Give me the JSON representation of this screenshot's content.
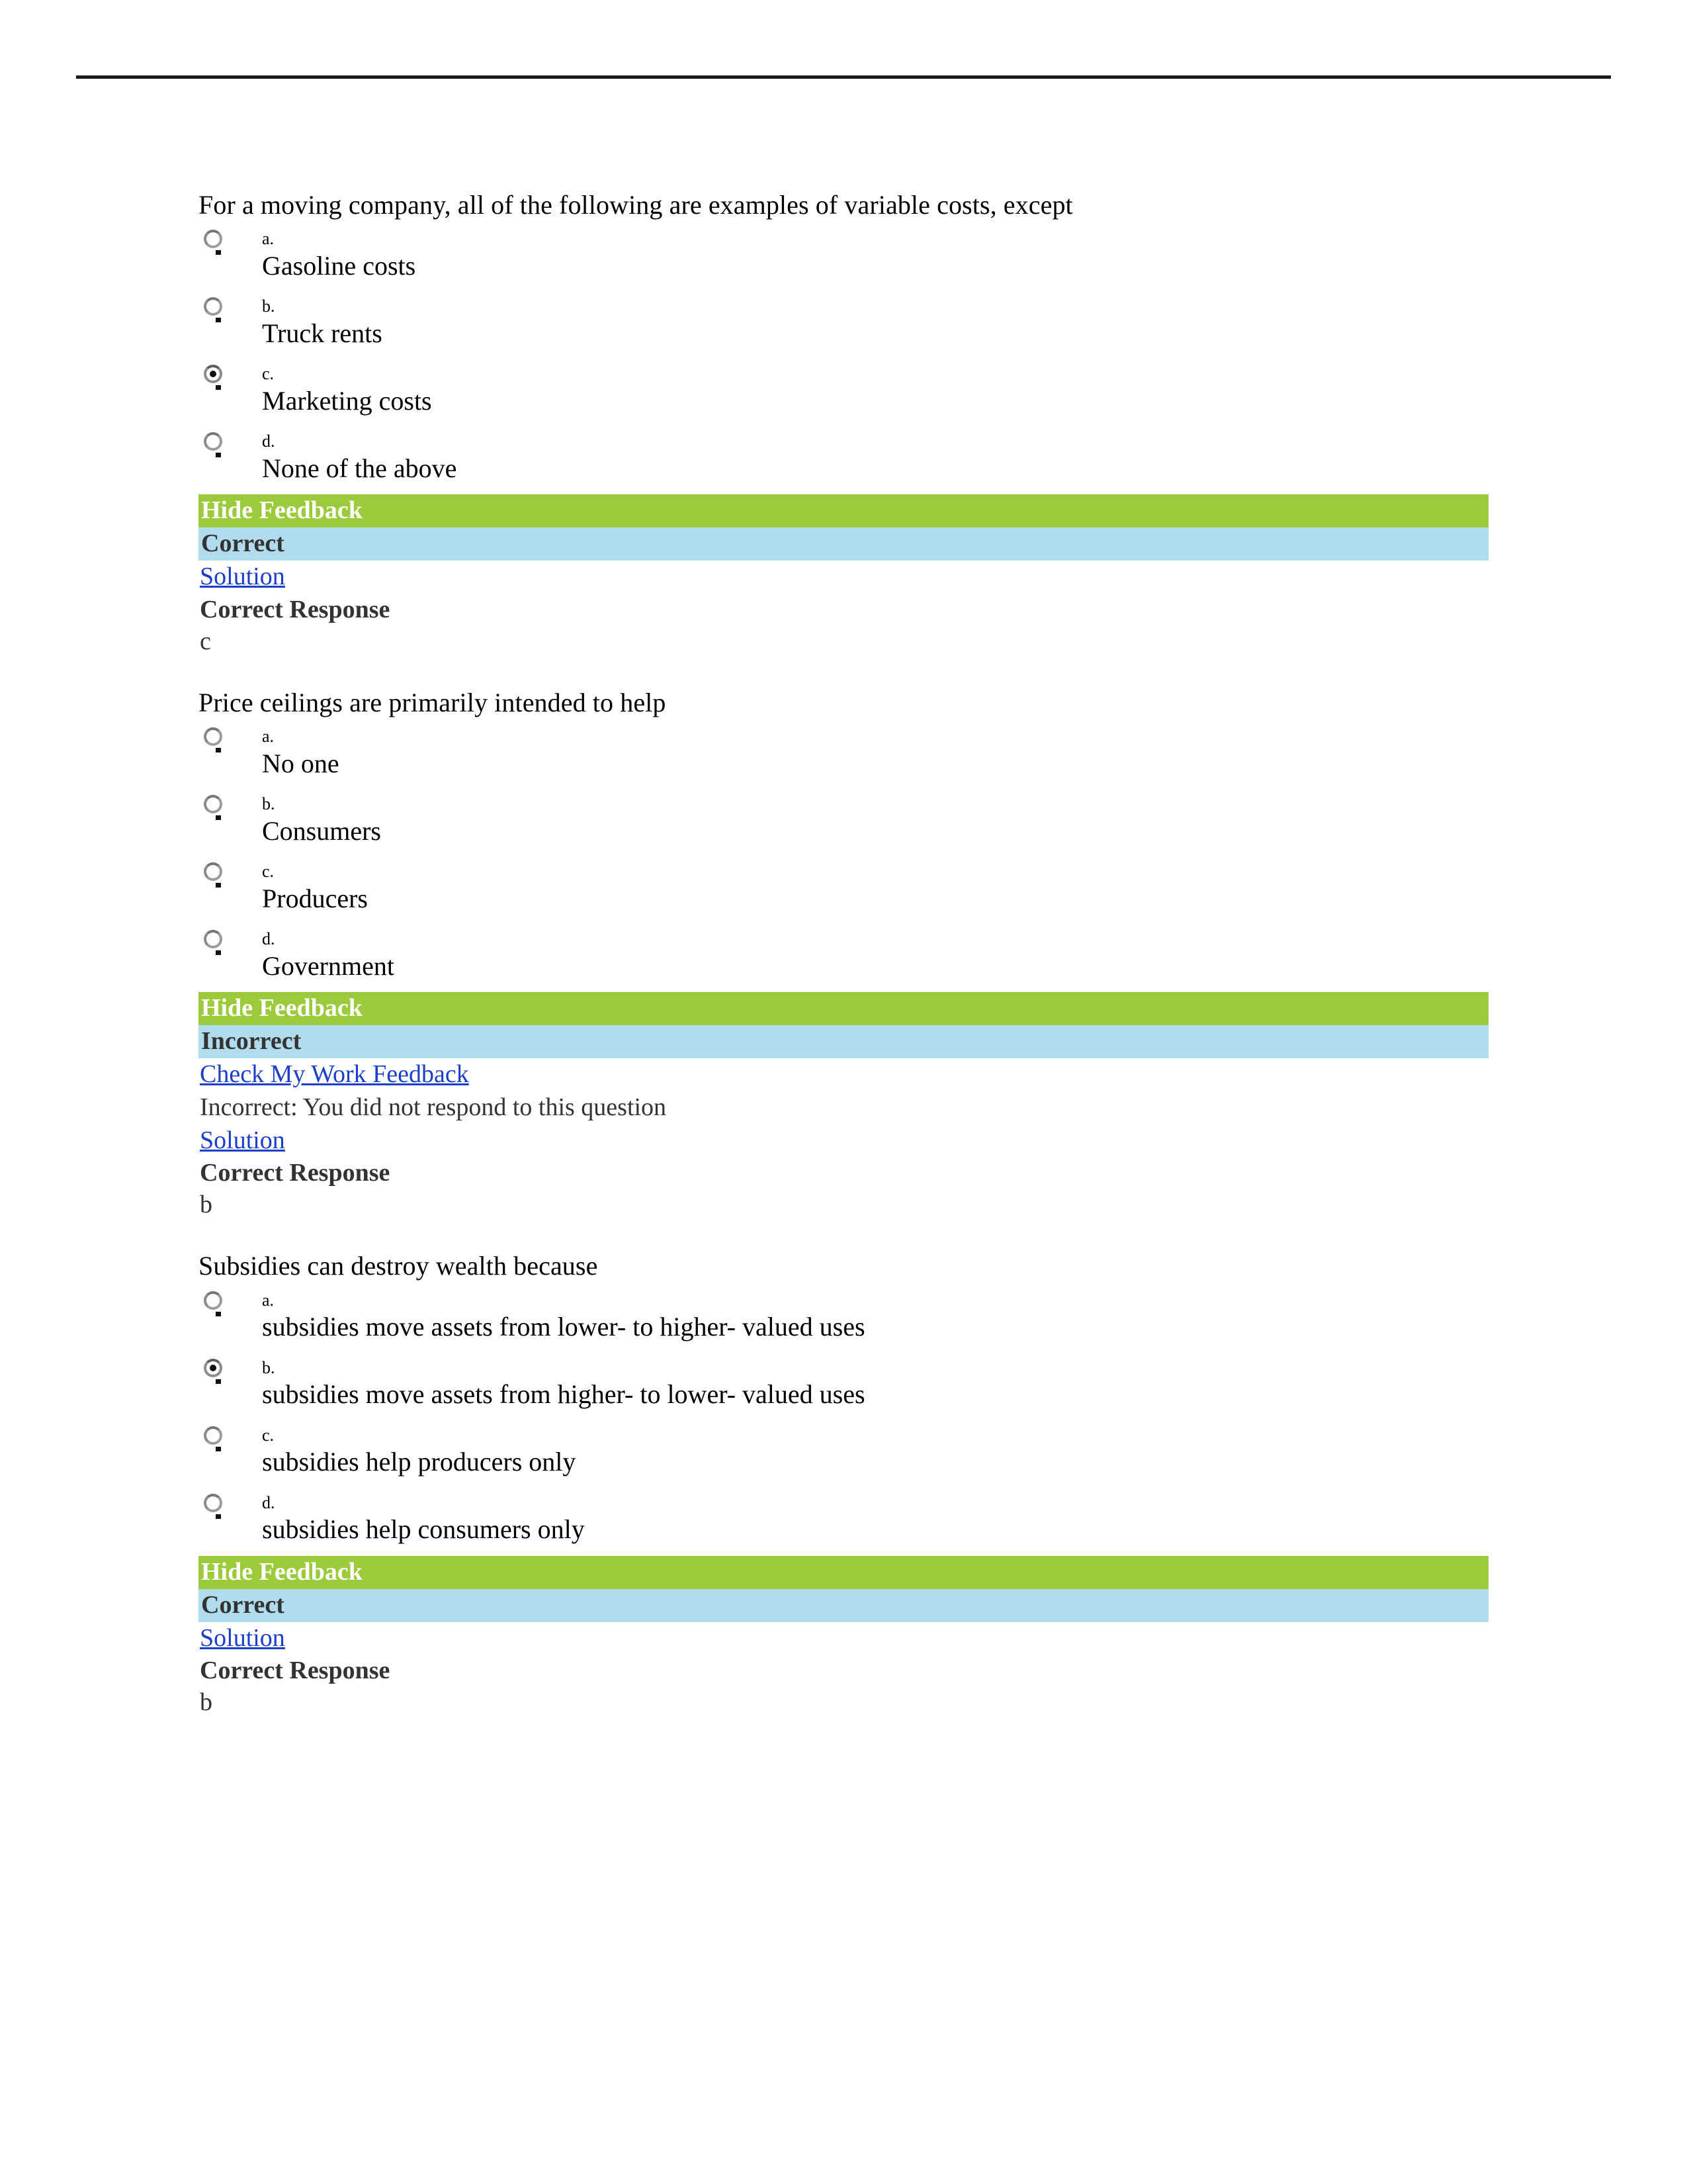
{
  "document": {
    "has_top_rule": true,
    "accent_colors": {
      "feedback_header_green": "#9bca3c",
      "status_bar_blue": "#b1dcee",
      "link_blue": "#1b3fc9",
      "text_gray": "#333333"
    }
  },
  "questions": [
    {
      "stem": "For a moving company, all of the following are examples of variable costs, except",
      "options": [
        {
          "letter": "a.",
          "text": "Gasoline costs",
          "selected": false
        },
        {
          "letter": "b.",
          "text": "Truck rents",
          "selected": false
        },
        {
          "letter": "c.",
          "text": "Marketing costs",
          "selected": true
        },
        {
          "letter": "d.",
          "text": "None of the above",
          "selected": false
        }
      ],
      "feedback": {
        "hide_label": "Hide Feedback",
        "status": "Correct",
        "check_my_work_link": null,
        "check_my_work_text": null,
        "solution_link": "Solution",
        "correct_response_label": "Correct Response",
        "correct_response_value": "c"
      }
    },
    {
      "stem": "Price ceilings are primarily intended to help",
      "options": [
        {
          "letter": "a.",
          "text": "No one",
          "selected": false
        },
        {
          "letter": "b.",
          "text": "Consumers",
          "selected": false
        },
        {
          "letter": "c.",
          "text": "Producers",
          "selected": false
        },
        {
          "letter": "d.",
          "text": "Government",
          "selected": false
        }
      ],
      "feedback": {
        "hide_label": "Hide Feedback",
        "status": "Incorrect",
        "check_my_work_link": "Check My Work Feedback",
        "check_my_work_text": "Incorrect: You did not respond to this question",
        "solution_link": "Solution",
        "correct_response_label": "Correct Response",
        "correct_response_value": "b"
      }
    },
    {
      "stem": "Subsidies can destroy wealth because",
      "options": [
        {
          "letter": "a.",
          "text": "subsidies move assets from lower- to higher- valued uses",
          "selected": false
        },
        {
          "letter": "b.",
          "text": "subsidies move assets from higher- to lower- valued uses",
          "selected": true
        },
        {
          "letter": "c.",
          "text": "subsidies help producers only",
          "selected": false
        },
        {
          "letter": "d.",
          "text": "subsidies help consumers only",
          "selected": false
        }
      ],
      "feedback": {
        "hide_label": "Hide Feedback",
        "status": "Correct",
        "check_my_work_link": null,
        "check_my_work_text": null,
        "solution_link": "Solution",
        "correct_response_label": "Correct Response",
        "correct_response_value": "b"
      }
    }
  ]
}
